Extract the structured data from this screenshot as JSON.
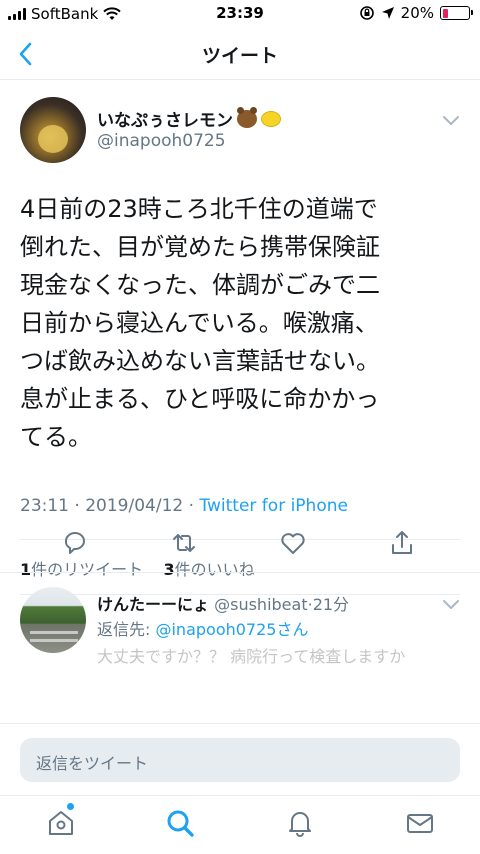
{
  "status_bar": {
    "carrier": "SoftBank",
    "time": "23:39",
    "battery_percent": "20%",
    "battery_level": 0.2,
    "battery_color": "#e0245e"
  },
  "nav": {
    "title": "ツイート",
    "back_icon": "chevron-left-icon"
  },
  "tweet": {
    "display_name": "いなぷぅさレモン",
    "handle": "@inapooh0725",
    "text_lines": [
      "4日前の23時ころ北千住の道端で",
      "倒れた、目が覚めたら携帯保険証",
      "現金なくなった、体調がごみで二",
      "日前から寝込んでいる。喉激痛、",
      "つば飲み込めない言葉話せない。",
      "息が止まる、ひと呼吸に命かかっ",
      "てる。"
    ],
    "time": "23:11",
    "separator": " · ",
    "date": "2019/04/12",
    "source": "Twitter for iPhone",
    "retweet_count": "1",
    "retweet_label": "件のリツイート",
    "like_count": "3",
    "like_label": "件のいいね"
  },
  "reply": {
    "name": "けんたーーにょ",
    "handle": "@sushibeat",
    "age": "21分",
    "replying_to_label": "返信先: ",
    "replying_to_handle": "@inapooh0725",
    "replying_to_suffix": "さん",
    "preview": "大丈夫ですか？？ 病院行って検査しますか"
  },
  "compose": {
    "placeholder": "返信をツイート"
  },
  "colors": {
    "accent": "#1da1f2",
    "secondary_text": "#657786",
    "primary_text": "#14171a"
  }
}
